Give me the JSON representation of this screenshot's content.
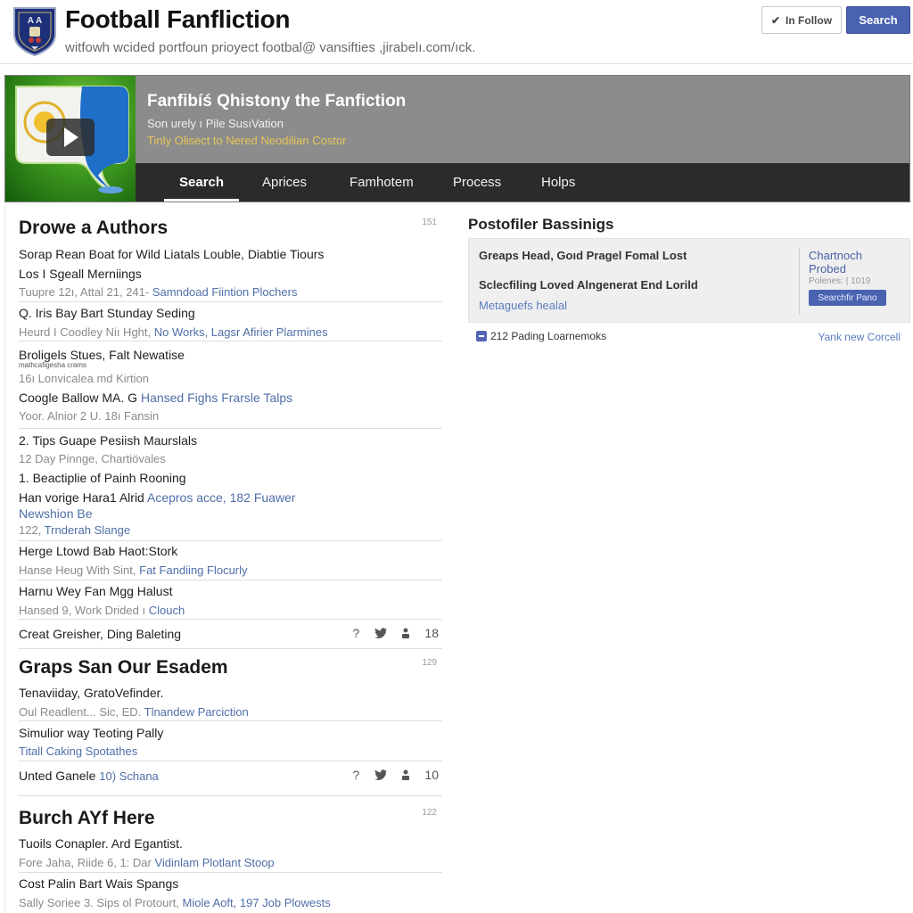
{
  "header": {
    "title": "Football Fanfliction",
    "subtitle": "witfowh wcided portfoun prioyect footbal@ vansifties ,jirabelı.com/ıck.",
    "follow_label": "In Follow",
    "search_label": "Search",
    "logo_icon": "crest-shield-icon"
  },
  "banner": {
    "title": "Fanfibíś Qhistony the Fanfiction",
    "subtitle": "Son urely ı Pile SusıVation",
    "link": "Tinly Olisect to Nered Neodilian Costor",
    "thumbnail_icon": "video-play-icon",
    "nav": [
      {
        "label": "Search",
        "active": true
      },
      {
        "label": "Aprices",
        "active": false
      },
      {
        "label": "Famhotem",
        "active": false
      },
      {
        "label": "Process",
        "active": false
      },
      {
        "label": "Holps",
        "active": false
      }
    ]
  },
  "sections": [
    {
      "title": "Drowe a Authors",
      "count": "151",
      "items": [
        {
          "title": "Sorap Rean Boat for Wild Liatals Louble, Diabtie Tiours",
          "title2": "Los I Sgeall Merniings",
          "meta": "Tuupre 12ı, Attal 21, 241-",
          "meta_link": "Samndoad Fiintion Plochers"
        },
        {
          "title": "Q. Iris Bay Bart Stunday Seding",
          "meta": "Heurd I Coodley Niı Hght,",
          "meta_link": "No Works, Lagsr Afirier Plarmines"
        },
        {
          "title": "Broligels Stues, Falt Newatise",
          "tiny": "mathcafigesha crams",
          "meta": "16ı Lonvicalea md Kirtion"
        },
        {
          "title": "Coogle Ballow MA. G",
          "title_link": "Hansed Fighs Frarsle Talps",
          "meta": "Yoor. Alnior 2 U. 18ı Fansin"
        },
        {
          "title": "2. Tips Guape Pesiish Maurslals",
          "meta": "12 Day Pinnge, Chartiövales"
        },
        {
          "title": "1. Beactiplie of Painh Rooning",
          "title2": "Han vorige Hara1 Alrid",
          "title2_link": "Acepros acce, 182 Fuawer",
          "title3_link": "Newshion Be",
          "meta": "122,",
          "meta_link": "Trnderah Slange"
        },
        {
          "title": "Herge Ltowd Bab Haot:Stork",
          "meta": "Hanse Heug With Sint,",
          "meta_link": "Fat Fandiing Flocurly"
        },
        {
          "title": "Harnu Wey Fan Mgg Halust",
          "meta": "Hansed 9, Work Drided ı",
          "meta_link": "Clouch"
        },
        {
          "title": "Creat Greisher, Ding Baleting",
          "icons": [
            "question-icon",
            "twitter-bird-icon",
            "person-icon"
          ],
          "stat": "18"
        }
      ]
    },
    {
      "title": "Graps San Our Esadem",
      "count": "129",
      "items": [
        {
          "title": "Tenaviiday, GratoVefinder.",
          "meta": "Oul Readlent... Sic, ED.",
          "meta_link": "Tlnandew Parciction"
        },
        {
          "title": "Simulior way Teoting Pally",
          "meta_link": "Titall Caking Spotathes"
        },
        {
          "title": "Unted Ganele",
          "title_link": "10) Schana",
          "icons": [
            "question-icon",
            "twitter-bird-icon",
            "person-icon"
          ],
          "stat": "10"
        }
      ]
    },
    {
      "title": "Burch AYf Here",
      "count": "122",
      "items": [
        {
          "title": "Tuoils Conapler. Ard Egantist.",
          "meta": "Fore Jaha, Riide 6, 1: Dar",
          "meta_link": "Vidinlam Plotlant Stoop"
        },
        {
          "title": "Cost Palin Bart Wais Spangs",
          "meta": "Sally Soriee 3. Sips ol Protourt,",
          "meta_link": "Miole Aoft, 197 Job Plowests"
        }
      ]
    }
  ],
  "sidebar": {
    "title": "Postofiler Bassinigs",
    "box": {
      "line1": "Greaps Head, Goıd Pragel Fomal Lost",
      "line2": "Sclecfiling Loved Alngenerat End Lorild",
      "link": "Metaguefs healal",
      "side_title": "Chartnoch Probed",
      "side_meta": "Polenes: | 1019",
      "side_button": "Searchfir Pano"
    },
    "footer_text": "212 Pading Loarnemoks",
    "footer_link": "Yank new Corcell"
  },
  "colors": {
    "accent": "#4a63b0",
    "link": "#4f6fa8",
    "banner_link": "#e6c65a",
    "nav_bg": "#2b2b2b",
    "banner_bg": "#8c8c8c"
  }
}
